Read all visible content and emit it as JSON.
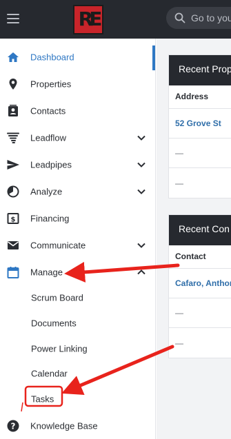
{
  "header": {
    "logo_text": "RE",
    "search_placeholder": "Go to you"
  },
  "sidebar": {
    "items": [
      {
        "label": "Dashboard",
        "icon": "home-icon",
        "active": true
      },
      {
        "label": "Properties",
        "icon": "map-pin-icon"
      },
      {
        "label": "Contacts",
        "icon": "contacts-icon"
      },
      {
        "label": "Leadflow",
        "icon": "funnel-tornado-icon",
        "expandable": true
      },
      {
        "label": "Leadpipes",
        "icon": "send-icon",
        "expandable": true
      },
      {
        "label": "Analyze",
        "icon": "pie-icon",
        "expandable": true
      },
      {
        "label": "Financing",
        "icon": "dollar-icon"
      },
      {
        "label": "Communicate",
        "icon": "envelope-icon",
        "expandable": true
      },
      {
        "label": "Manage",
        "icon": "calendar-icon",
        "expanded": true
      },
      {
        "label": "Knowledge Base",
        "icon": "question-icon"
      }
    ],
    "manage_sub": [
      "Scrum Board",
      "Documents",
      "Power Linking",
      "Calendar",
      "Tasks"
    ]
  },
  "cards": {
    "properties": {
      "title": "Recent Prop",
      "column": "Address",
      "rows": [
        "52 Grove St",
        "—",
        "—"
      ]
    },
    "contacts": {
      "title": "Recent Con",
      "column": "Contact",
      "rows": [
        "Cafaro, Anthon",
        "—",
        "—"
      ]
    }
  },
  "colors": {
    "topbar": "#26292f",
    "accent": "#2f78c4",
    "annotation": "#e8231c",
    "logo": "#c8242a"
  }
}
